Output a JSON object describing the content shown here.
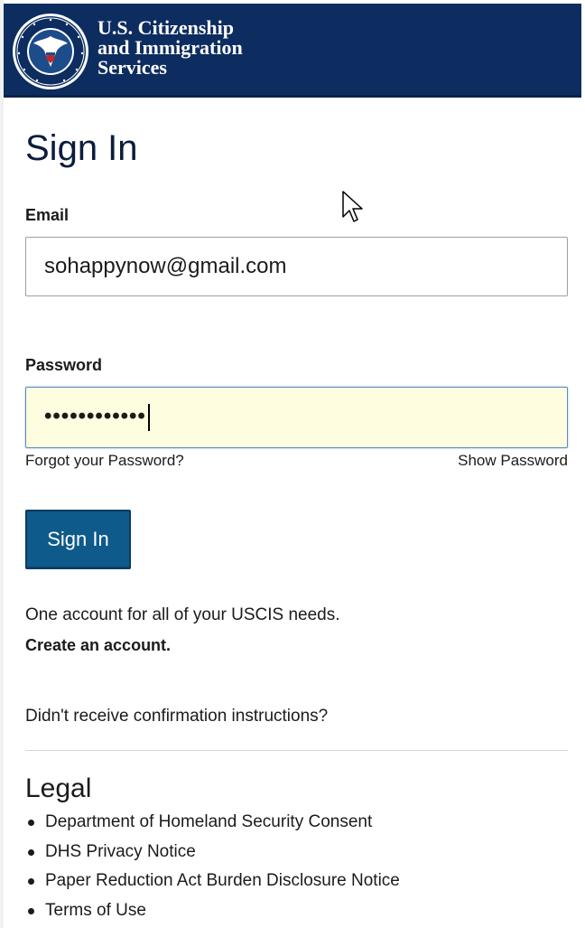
{
  "header": {
    "brand_line1": "U.S. Citizenship",
    "brand_line2": "and Immigration",
    "brand_line3": "Services",
    "seal_text": "U.S. DEPARTMENT OF HOMELAND SECURITY",
    "background_color": "#0d2d60"
  },
  "form": {
    "title": "Sign In",
    "email_label": "Email",
    "email_value": "sohappynow@gmail.com",
    "password_label": "Password",
    "password_value": "••••••••••••",
    "forgot_link": "Forgot your Password?",
    "show_password": "Show Password",
    "signin_button": "Sign In",
    "button_color": "#0e5a8a"
  },
  "account": {
    "tagline": "One account for all of your USCIS needs.",
    "create_link": "Create an account.",
    "confirmation_link": "Didn't receive confirmation instructions?"
  },
  "legal": {
    "title": "Legal",
    "items": [
      "Department of Homeland Security Consent",
      "DHS Privacy Notice",
      "Paper Reduction Act Burden Disclosure Notice",
      "Terms of Use"
    ]
  },
  "icons": {
    "seal": "dhs-seal-icon",
    "cursor": "mouse-pointer-icon"
  }
}
